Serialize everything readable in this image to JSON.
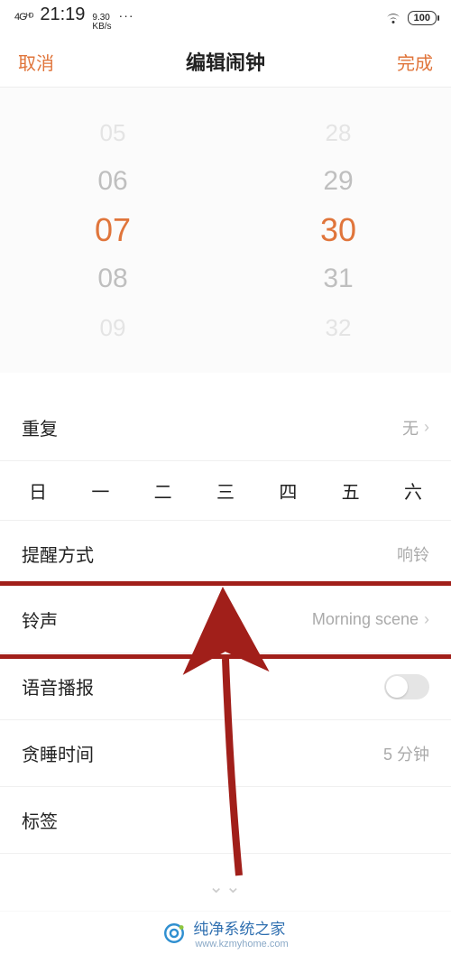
{
  "status": {
    "signal": "4Gᴴᴰ",
    "time": "21:19",
    "kbs_top": "9.30",
    "kbs_bot": "KB/s",
    "dots": "···",
    "battery": "100"
  },
  "nav": {
    "cancel": "取消",
    "title": "编辑闹钟",
    "done": "完成"
  },
  "picker": {
    "hours": [
      "05",
      "06",
      "07",
      "08",
      "09"
    ],
    "minutes": [
      "28",
      "29",
      "30",
      "31",
      "32"
    ],
    "selected_index": 2
  },
  "settings": {
    "repeat_label": "重复",
    "repeat_value": "无",
    "weekdays": [
      "日",
      "一",
      "二",
      "三",
      "四",
      "五",
      "六"
    ],
    "remind_label": "提醒方式",
    "remind_value": "响铃",
    "ringtone_label": "铃声",
    "ringtone_value": "Morning scene",
    "voice_label": "语音播报",
    "voice_on": false,
    "snooze_label": "贪睡时间",
    "snooze_value": "5 分钟",
    "tag_label": "标签"
  },
  "footer": {
    "brand": "纯净系统之家",
    "url": "www.kzmyhome.com"
  },
  "colors": {
    "accent": "#e0753b",
    "highlight": "#a11f1a"
  }
}
